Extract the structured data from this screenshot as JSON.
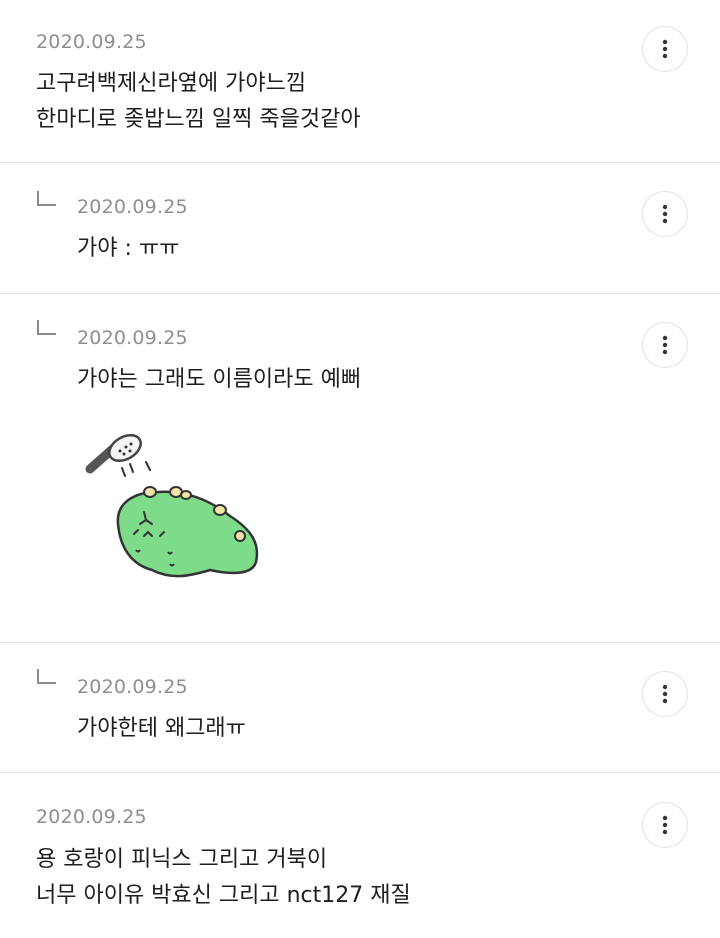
{
  "comments": [
    {
      "date": "2020.09.25",
      "text": "고구려백제신라옆에 가야느낌\n한마디로 좆밥느낌 일찍 죽을것같아",
      "is_reply": false
    },
    {
      "date": "2020.09.25",
      "text": "가야 : ㅠㅠ",
      "is_reply": true
    },
    {
      "date": "2020.09.25",
      "text": "가야는 그래도 이름이라도 예뻐",
      "is_reply": true,
      "sticker": "green-dinosaur-shower-sticker"
    },
    {
      "date": "2020.09.25",
      "text": "가야한테 왜그래ㅠ",
      "is_reply": true
    },
    {
      "date": "2020.09.25",
      "text": "용 호랑이 피닉스 그리고 거북이\n너무 아이유 박효신 그리고 nct127 재질",
      "is_reply": false
    }
  ],
  "icons": {
    "more": "more-vertical-icon",
    "reply": "reply-arrow-icon"
  },
  "colors": {
    "date": "#8e8e8e",
    "divider": "#e4e4e4",
    "sticker_body": "#7ddb8a"
  }
}
